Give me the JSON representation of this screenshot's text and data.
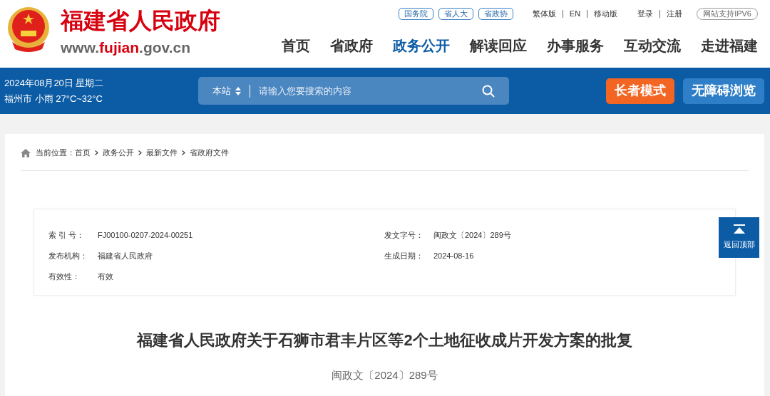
{
  "header": {
    "site_name": "福建省人民政府",
    "url": {
      "before": "www.",
      "highlight": "fujian",
      "after": ".gov.cn"
    },
    "links": [
      "国务院",
      "省人大",
      "省政协"
    ],
    "versions": [
      "繁体版",
      "EN",
      "移动版"
    ],
    "account": [
      "登录",
      "注册"
    ],
    "ipv6": "网站支持IPV6",
    "nav": [
      {
        "label": "首页",
        "selected": false
      },
      {
        "label": "省政府",
        "selected": false
      },
      {
        "label": "政务公开",
        "selected": true
      },
      {
        "label": "解读回应",
        "selected": false
      },
      {
        "label": "办事服务",
        "selected": false
      },
      {
        "label": "互动交流",
        "selected": false
      },
      {
        "label": "走进福建",
        "selected": false
      }
    ]
  },
  "banner": {
    "date": "2024年08月20日 星期二",
    "weather": "福州市 小雨 27°C~32°C",
    "search_scope": "本站",
    "search_placeholder": "请输入您要搜索的内容",
    "buttons": [
      "长者模式",
      "无障碍浏览"
    ]
  },
  "breadcrumb": {
    "label": "当前位置：",
    "items": [
      "首页",
      "政务公开",
      "最新文件",
      "省政府文件"
    ]
  },
  "meta": [
    [
      {
        "label": "索 引 号：",
        "value": "FJ00100-0207-2024-00251"
      },
      {
        "label": "发文字号：",
        "value": "闽政文〔2024〕289号"
      }
    ],
    [
      {
        "label": "发布机构：",
        "value": "福建省人民政府"
      },
      {
        "label": "生成日期：",
        "value": "2024-08-16"
      }
    ],
    [
      {
        "label": "有效性：",
        "value": "有效"
      }
    ]
  ],
  "document": {
    "title": "福建省人民政府关于石狮市君丰片区等2个土地征收成片开发方案的批复",
    "number": "闽政文〔2024〕289号"
  },
  "back_to_top": "返回顶部"
}
